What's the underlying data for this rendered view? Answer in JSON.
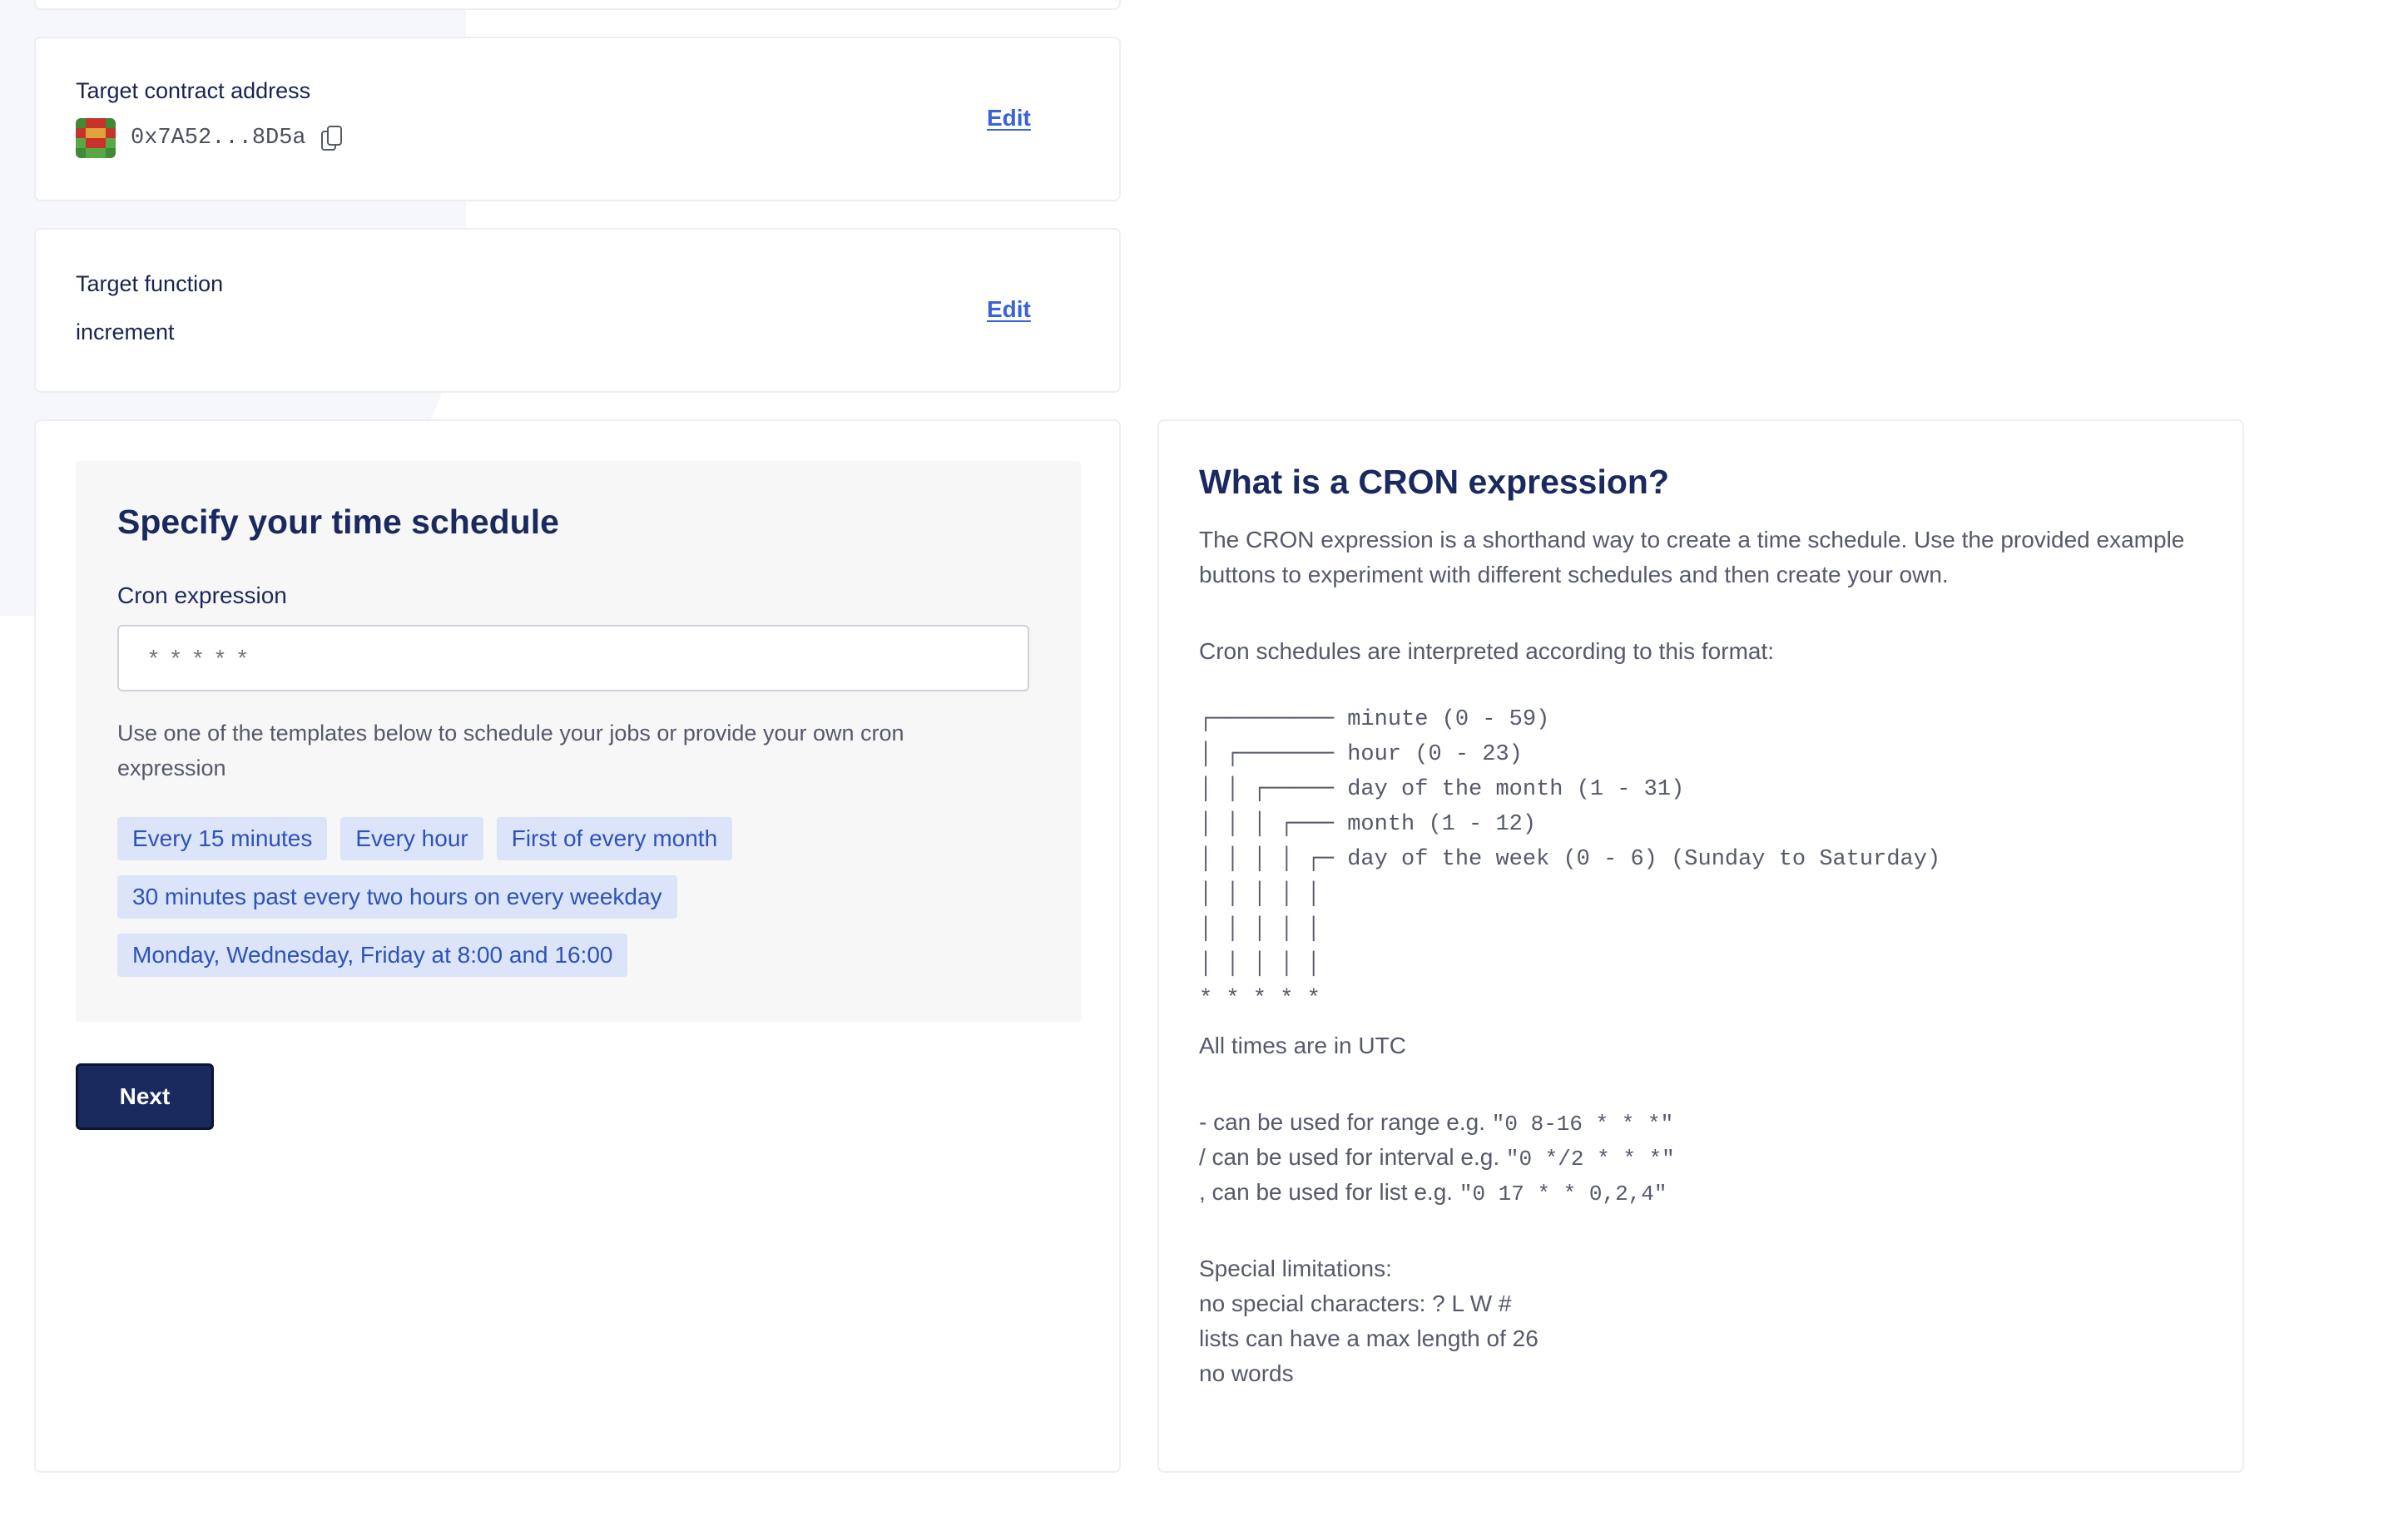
{
  "contract": {
    "label": "Target contract address",
    "address": "0x7A52...8D5a",
    "edit_label": "Edit"
  },
  "function": {
    "label": "Target function",
    "value": "increment",
    "edit_label": "Edit"
  },
  "schedule": {
    "title": "Specify your time schedule",
    "cron_label": "Cron expression",
    "cron_placeholder": "* * * * *",
    "cron_value": "",
    "help": "Use one of the templates below to schedule your jobs or provide your own cron expression",
    "templates": [
      [
        "Every 15 minutes",
        "Every hour",
        "First of every month"
      ],
      [
        "30 minutes past every two hours on every weekday"
      ],
      [
        "Monday, Wednesday, Friday at 8:00 and 16:00"
      ]
    ],
    "next_label": "Next"
  },
  "info": {
    "title": "What is a CRON expression?",
    "intro": "The CRON expression is a shorthand way to create a time schedule. Use the provided example buttons to experiment with different schedules and then create your own.",
    "format_intro": "Cron schedules are interpreted according to this format:",
    "format_diagram": "┌───────── minute (0 - 59)\n│ ┌─────── hour (0 - 23)\n│ │ ┌───── day of the month (1 - 31)\n│ │ │ ┌─── month (1 - 12)\n│ │ │ │ ┌─ day of the week (0 - 6) (Sunday to Saturday)\n│ │ │ │ │\n│ │ │ │ │\n│ │ │ │ │\n* * * * *",
    "utc_note": "All times are in UTC",
    "range_text": "- can be used for range e.g. ",
    "range_example": "\"0 8-16 * * *\"",
    "interval_text": "/ can be used for interval e.g. ",
    "interval_example": "\"0 */2 * * *\"",
    "list_text": ", can be used for list e.g. ",
    "list_example": "\"0 17 * * 0,2,4\"",
    "limitations_title": "Special limitations:",
    "limitations": [
      "no special characters: ? L W #",
      "lists can have a max length of 26",
      "no words"
    ]
  },
  "colors": {
    "brand_navy": "#1a2a5e",
    "link_blue": "#3b62d6",
    "chip_bg": "#dbe4f8",
    "chip_text": "#2d53b8"
  }
}
